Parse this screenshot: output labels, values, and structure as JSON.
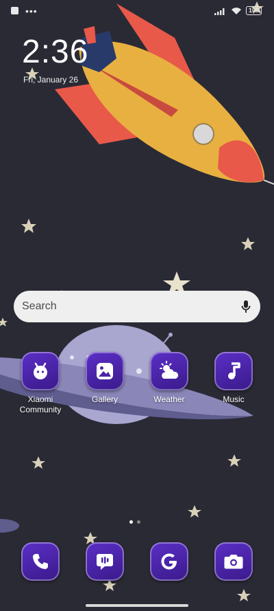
{
  "status_bar": {
    "battery": "100"
  },
  "lock": {
    "time": "2:36",
    "date": "Fri, January 26"
  },
  "search": {
    "placeholder": "Search"
  },
  "apps": [
    {
      "label": "Xiaomi\nCommunity",
      "icon": "xiaomi-community-icon"
    },
    {
      "label": "Gallery",
      "icon": "gallery-icon"
    },
    {
      "label": "Weather",
      "icon": "weather-icon"
    },
    {
      "label": "Music",
      "icon": "music-note-icon"
    }
  ],
  "dock": [
    {
      "icon": "phone-icon"
    },
    {
      "icon": "messages-icon"
    },
    {
      "icon": "google-icon"
    },
    {
      "icon": "camera-icon"
    }
  ],
  "colors": {
    "background": "#2a2a35",
    "icon_purple": "#4a24a8",
    "rocket_yellow": "#e8b040",
    "rocket_red": "#e85a48",
    "planet": "#a9a6d0"
  }
}
